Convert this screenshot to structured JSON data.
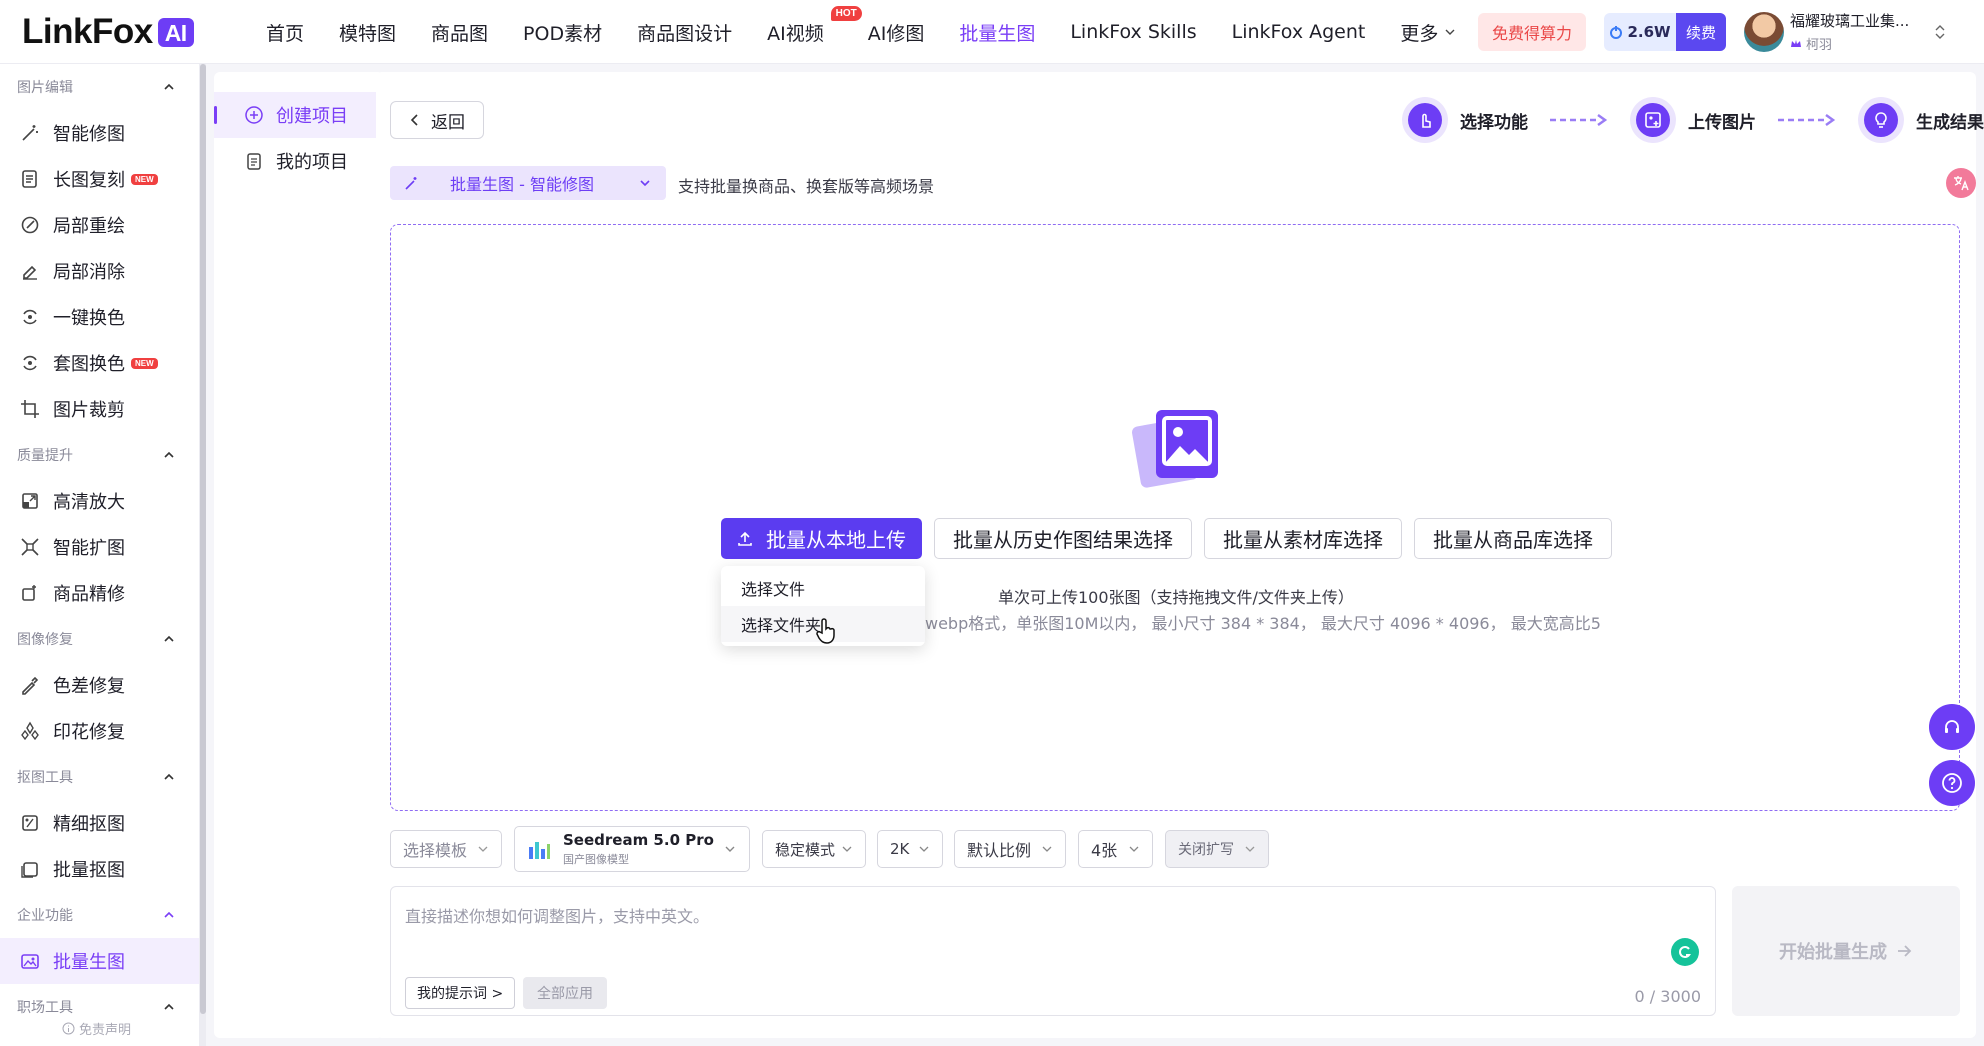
{
  "brand": {
    "name": "LinkFox",
    "badge": "AI"
  },
  "nav": [
    {
      "label": "首页"
    },
    {
      "label": "模特图"
    },
    {
      "label": "商品图"
    },
    {
      "label": "POD素材"
    },
    {
      "label": "商品图设计"
    },
    {
      "label": "AI视频",
      "badge": "HOT"
    },
    {
      "label": "AI修图"
    },
    {
      "label": "批量生图",
      "active": true
    },
    {
      "label": "LinkFox Skills"
    },
    {
      "label": "LinkFox Agent"
    },
    {
      "label": "更多"
    }
  ],
  "header": {
    "free_label": "免费得算力",
    "credits": "2.6W",
    "renew_label": "续费",
    "user_name": "福耀玻璃工业集...",
    "user_sub": "柯羽"
  },
  "sidebar": {
    "sections": [
      {
        "title": "图片编辑",
        "items": [
          {
            "label": "智能修图",
            "icon": "magic-wand-icon"
          },
          {
            "label": "长图复刻",
            "icon": "document-icon",
            "badge": "NEW"
          },
          {
            "label": "局部重绘",
            "icon": "brush-icon"
          },
          {
            "label": "局部消除",
            "icon": "eraser-icon"
          },
          {
            "label": "一键换色",
            "icon": "color-swap-icon"
          },
          {
            "label": "套图换色",
            "icon": "color-swap-icon",
            "badge": "NEW"
          },
          {
            "label": "图片裁剪",
            "icon": "crop-icon"
          }
        ]
      },
      {
        "title": "质量提升",
        "items": [
          {
            "label": "高清放大",
            "icon": "upscale-icon"
          },
          {
            "label": "智能扩图",
            "icon": "expand-icon"
          },
          {
            "label": "商品精修",
            "icon": "retouch-icon"
          }
        ]
      },
      {
        "title": "图像修复",
        "items": [
          {
            "label": "色差修复",
            "icon": "pipette-icon"
          },
          {
            "label": "印花修复",
            "icon": "pattern-icon"
          }
        ]
      },
      {
        "title": "抠图工具",
        "items": [
          {
            "label": "精细抠图",
            "icon": "cutout-icon"
          },
          {
            "label": "批量抠图",
            "icon": "batch-cutout-icon"
          }
        ]
      },
      {
        "title": "企业功能",
        "items": [
          {
            "label": "批量生图",
            "icon": "image-icon",
            "active": true
          }
        ]
      },
      {
        "title": "职场工具",
        "items": []
      }
    ],
    "disclaimer": "免责声明"
  },
  "projects": {
    "create_label": "创建项目",
    "mine_label": "我的项目"
  },
  "main": {
    "back_label": "返回",
    "steps": [
      "选择功能",
      "上传图片",
      "生成结果"
    ],
    "mode_label": "批量生图 - 智能修图",
    "mode_desc": "支持批量换商品、换套版等高频场景",
    "upload_buttons": {
      "local": "批量从本地上传",
      "history": "批量从历史作图结果选择",
      "library": "批量从素材库选择",
      "products": "批量从商品库选择"
    },
    "upload_menu": [
      "选择文件",
      "选择文件夹"
    ],
    "hint_line1": "单次可上传100张图（支持拖拽文件/文件夹上传）",
    "hint_line2": "webp格式，单张图10M以内， 最小尺寸 384 * 384， 最大尺寸 4096 * 4096， 最大宽高比5"
  },
  "options": {
    "template": "选择模板",
    "model_name": "Seedream 5.0 Pro",
    "model_sub": "国产图像模型",
    "mode": "稳定模式",
    "resolution": "2K",
    "ratio": "默认比例",
    "count": "4张",
    "expand": "关闭扩写"
  },
  "prompt": {
    "placeholder": "直接描述你想如何调整图片，支持中英文。",
    "my_prompts_label": "我的提示词 >",
    "apply_all_label": "全部应用",
    "counter": "0 / 3000"
  },
  "generate_label": "开始批量生成",
  "colors": {
    "accent": "#6d3df5",
    "active_text": "#7a3ef6",
    "active_bg": "#f3eefe",
    "hot": "#f04040"
  }
}
